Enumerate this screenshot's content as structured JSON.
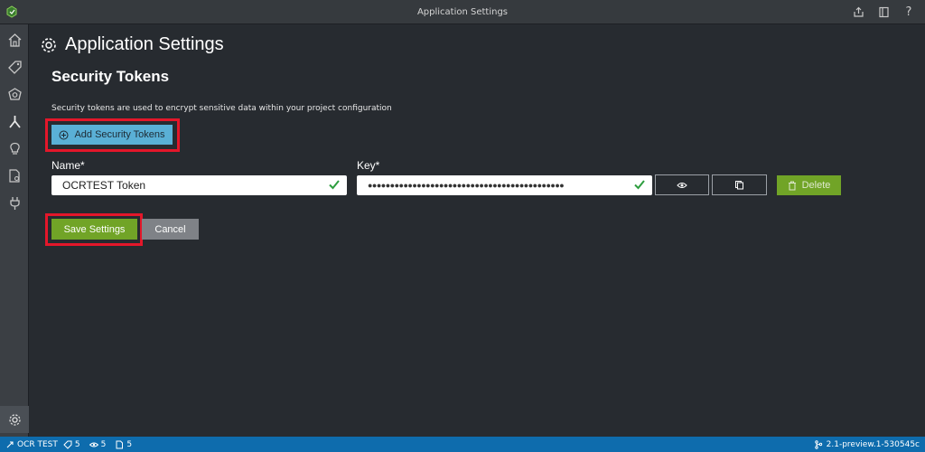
{
  "window": {
    "title": "Application Settings"
  },
  "page": {
    "title": "Application Settings",
    "section_title": "Security Tokens",
    "description": "Security tokens are used to encrypt sensitive data within your project configuration"
  },
  "actions": {
    "add_label": "Add Security Tokens",
    "save_label": "Save Settings",
    "cancel_label": "Cancel",
    "delete_label": "Delete"
  },
  "token": {
    "name_label": "Name*",
    "name_value": "OCRTEST Token",
    "key_label": "Key*",
    "key_masked": "●●●●●●●●●●●●●●●●●●●●●●●●●●●●●●●●●●●●●●●●●●●●"
  },
  "sidebar": {
    "items": [
      {
        "icon": "home-icon"
      },
      {
        "icon": "tag-icon"
      },
      {
        "icon": "model-icon"
      },
      {
        "icon": "merge-icon"
      },
      {
        "icon": "lightbulb-icon"
      },
      {
        "icon": "document-search-icon"
      },
      {
        "icon": "plug-icon"
      },
      {
        "icon": "gear-icon",
        "active": true
      }
    ]
  },
  "status": {
    "project": "OCR TEST",
    "tags_count": "5",
    "visited_count": "5",
    "assets_count": "5",
    "version": "2.1-preview.1-530545c"
  },
  "colors": {
    "accent_blue": "#5ab0d6",
    "save_green": "#71a427",
    "highlight_red": "#e4172a",
    "statusbar": "#0e6cad",
    "check_green": "#2e9e3f"
  }
}
